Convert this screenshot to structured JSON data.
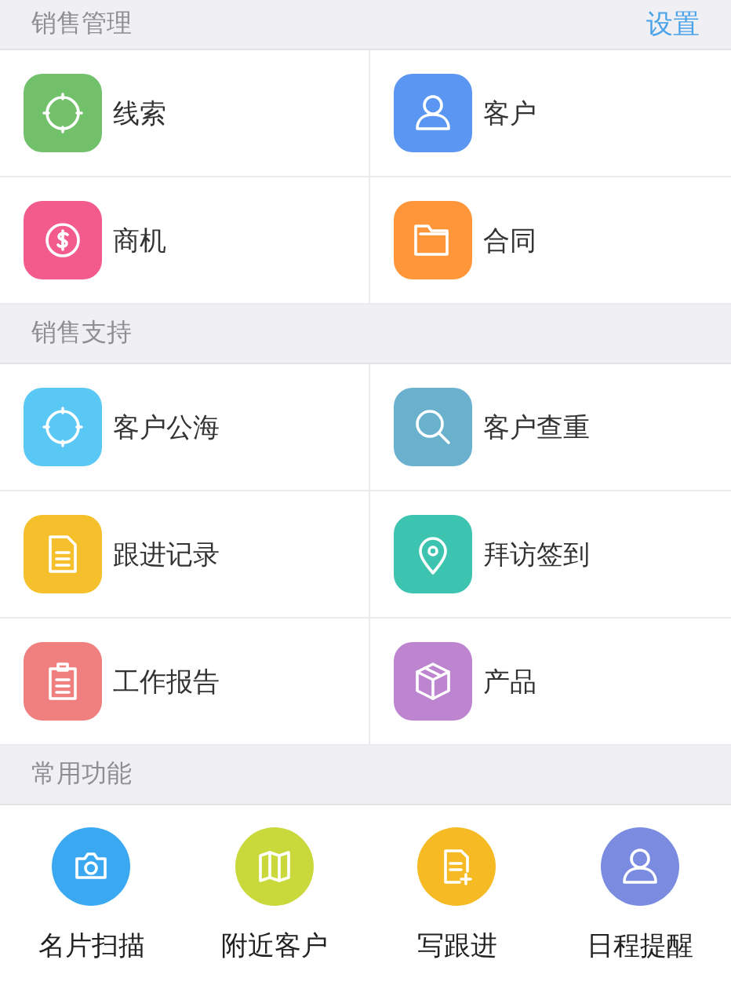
{
  "sections": [
    {
      "title": "销售管理",
      "action": "设置",
      "items": [
        {
          "label": "线索",
          "kind": "target",
          "color": "#72c06a"
        },
        {
          "label": "客户",
          "kind": "person",
          "color": "#5b96f3"
        },
        {
          "label": "商机",
          "kind": "dollar",
          "color": "#f25b8c"
        },
        {
          "label": "合同",
          "kind": "folder",
          "color": "#ff963a"
        }
      ]
    },
    {
      "title": "销售支持",
      "items": [
        {
          "label": "客户公海",
          "kind": "target",
          "color": "#5ac8f5"
        },
        {
          "label": "客户查重",
          "kind": "search",
          "color": "#69b1cc"
        },
        {
          "label": "跟进记录",
          "kind": "doc",
          "color": "#f6c02c"
        },
        {
          "label": "拜访签到",
          "kind": "pin",
          "color": "#3cc4b0"
        },
        {
          "label": "工作报告",
          "kind": "clipboard",
          "color": "#f07f80"
        },
        {
          "label": "产品",
          "kind": "box",
          "color": "#bd84cf"
        }
      ]
    }
  ],
  "quick": {
    "title": "常用功能",
    "items": [
      {
        "label": "名片扫描",
        "kind": "camera",
        "color": "#3aa9f2"
      },
      {
        "label": "附近客户",
        "kind": "map",
        "color": "#c9d83a"
      },
      {
        "label": "写跟进",
        "kind": "docplus",
        "color": "#f6bb24"
      },
      {
        "label": "日程提醒",
        "kind": "person",
        "color": "#7b8be0"
      }
    ]
  }
}
